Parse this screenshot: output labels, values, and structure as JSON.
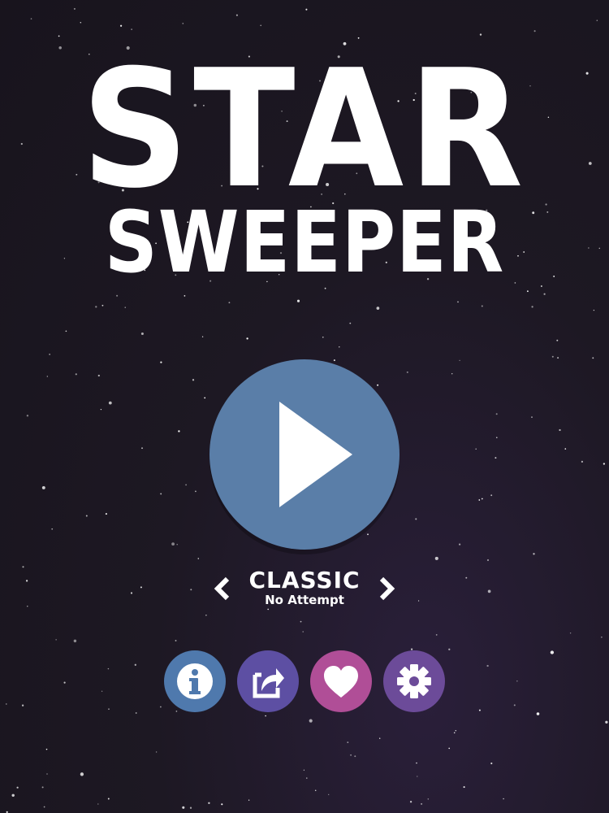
{
  "title": {
    "line1": "STAR",
    "line2": "SWEEPER"
  },
  "play_button": {
    "icon": "play-icon",
    "color": "#5a7ea8"
  },
  "mode": {
    "name": "CLASSIC",
    "status": "No Attempt",
    "prev_icon": "chevron-left-icon",
    "next_icon": "chevron-right-icon"
  },
  "buttons": [
    {
      "icon": "info-icon",
      "color": "#4f79ad"
    },
    {
      "icon": "share-icon",
      "color": "#5d4fa3"
    },
    {
      "icon": "heart-icon",
      "color": "#b04e97"
    },
    {
      "icon": "gear-icon",
      "color": "#6c4b99"
    }
  ],
  "colors": {
    "background": "#1c1721",
    "text": "#ffffff"
  }
}
